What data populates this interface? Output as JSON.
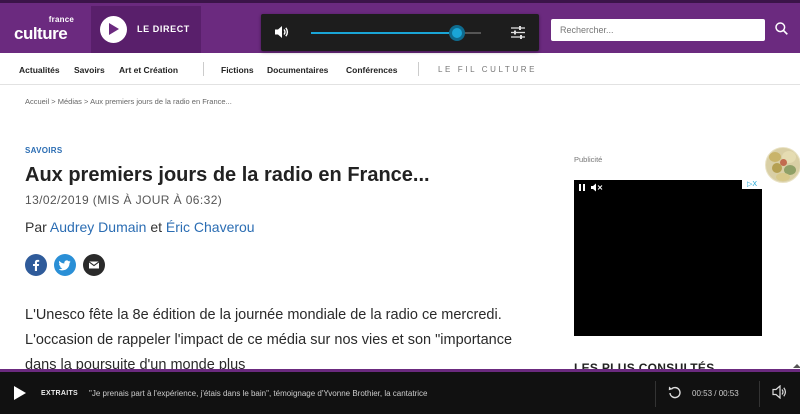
{
  "header": {
    "logo_small": "france",
    "logo_big": "culture",
    "direct_label": "LE DIRECT",
    "player": {
      "volume": 0.86
    },
    "search": {
      "placeholder": "Rechercher..."
    },
    "colors": {
      "brand": "#6b2a7f",
      "accent": "#1aa5d6"
    }
  },
  "nav": {
    "items": [
      "Actualités",
      "Savoirs",
      "Art et Création",
      "Fictions",
      "Documentaires",
      "Conférences"
    ],
    "fil": "LE FIL CULTURE"
  },
  "breadcrumb": [
    "Accueil",
    "Médias",
    "Aux premiers jours de la radio en France..."
  ],
  "article": {
    "category": "SAVOIRS",
    "title": "Aux premiers jours de la radio en France...",
    "date": "13/02/2019 (MIS À JOUR À 06:32)",
    "by": "Par",
    "and": "et",
    "author1": "Audrey Dumain",
    "author2": "Éric Chaverou",
    "share_icons": [
      "facebook-icon",
      "twitter-icon",
      "email-icon"
    ],
    "lead": "L'Unesco fête la 8e édition de la journée mondiale de la radio ce mercredi. L'occasion de rappeler l'impact de ce média sur nos vies et son \"importance dans la poursuite d'un monde plus"
  },
  "sidebar": {
    "ad_label": "Publicité",
    "ad_close": "▷X",
    "most_consulted": "LES PLUS CONSULTÉS"
  },
  "bottom_player": {
    "tag": "EXTRAITS",
    "text": "\"Je prenais part à l'expérience, j'étais dans le bain\", témoignage d'Yvonne Brothier, la cantatrice",
    "time": "00:53 / 00:53"
  }
}
